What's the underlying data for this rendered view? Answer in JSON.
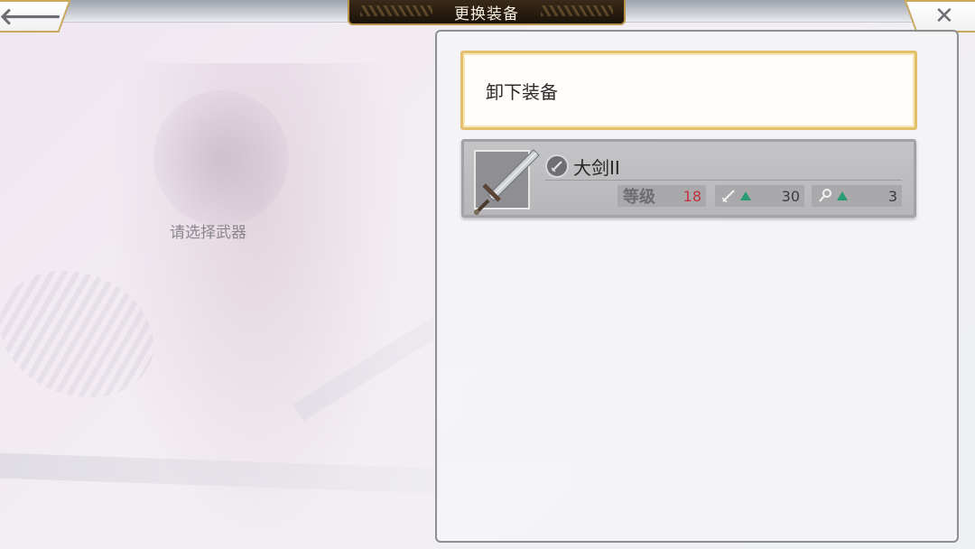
{
  "header": {
    "title": "更换装备",
    "back_icon": "back-arrow-icon",
    "close_icon": "close-icon"
  },
  "left": {
    "hint": "请选择武器"
  },
  "equip_list": {
    "unequip_label": "卸下装备",
    "items": [
      {
        "name": "大剑II",
        "type_icon": "sword-type-icon",
        "level_label": "等级",
        "level": "18",
        "attack_icon": "sword-stat-icon",
        "attack": "30",
        "skill_icon": "skill-stat-icon",
        "skill": "3"
      }
    ]
  },
  "colors": {
    "accent_gold": "#e3c06b",
    "level_red": "#c3333b",
    "up_green": "#2b9c72",
    "title_bg": "#1a120a"
  }
}
